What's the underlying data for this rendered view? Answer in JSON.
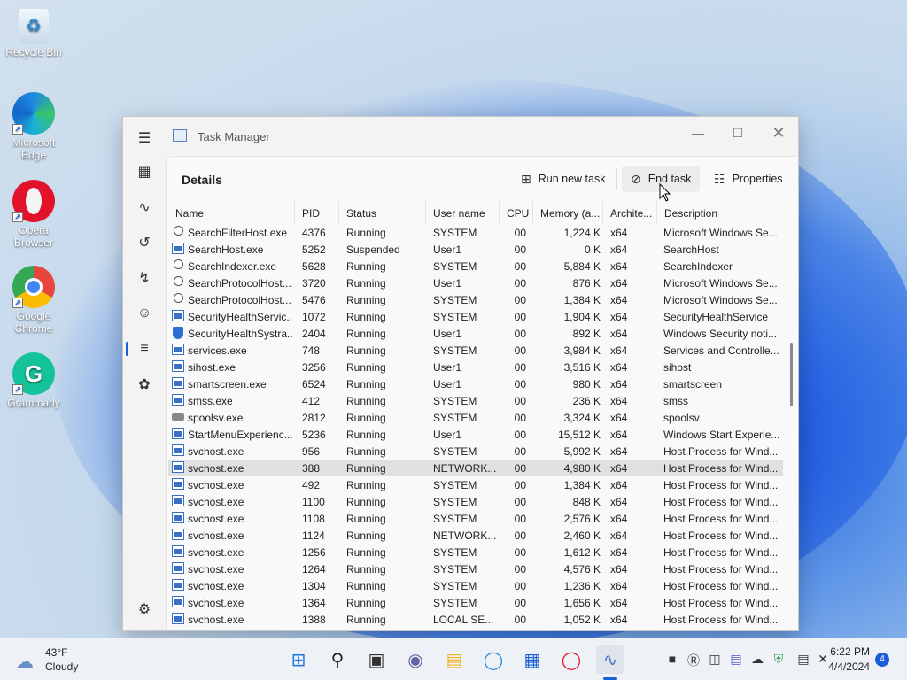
{
  "desktop": {
    "icons": [
      {
        "label": "Recycle Bin"
      },
      {
        "label": "Microsoft Edge"
      },
      {
        "label": "Opera Browser"
      },
      {
        "label": "Google Chrome"
      },
      {
        "label": "Grammarly"
      }
    ]
  },
  "window": {
    "title": "Task Manager",
    "page_title": "Details",
    "commands": {
      "run_new_task": "Run new task",
      "end_task": "End task",
      "properties": "Properties"
    }
  },
  "table": {
    "columns": [
      "Name",
      "PID",
      "Status",
      "User name",
      "CPU",
      "Memory (a...",
      "Archite...",
      "Description"
    ],
    "rows": [
      {
        "icon": "person",
        "name": "SearchFilterHost.exe",
        "pid": "4376",
        "status": "Running",
        "user": "SYSTEM",
        "cpu": "00",
        "mem": "1,224 K",
        "arch": "x64",
        "desc": "Microsoft Windows Se..."
      },
      {
        "icon": "app",
        "name": "SearchHost.exe",
        "pid": "5252",
        "status": "Suspended",
        "user": "User1",
        "cpu": "00",
        "mem": "0 K",
        "arch": "x64",
        "desc": "SearchHost"
      },
      {
        "icon": "person",
        "name": "SearchIndexer.exe",
        "pid": "5628",
        "status": "Running",
        "user": "SYSTEM",
        "cpu": "00",
        "mem": "5,884 K",
        "arch": "x64",
        "desc": "SearchIndexer"
      },
      {
        "icon": "person",
        "name": "SearchProtocolHost....",
        "pid": "3720",
        "status": "Running",
        "user": "User1",
        "cpu": "00",
        "mem": "876 K",
        "arch": "x64",
        "desc": "Microsoft Windows Se..."
      },
      {
        "icon": "person",
        "name": "SearchProtocolHost....",
        "pid": "5476",
        "status": "Running",
        "user": "SYSTEM",
        "cpu": "00",
        "mem": "1,384 K",
        "arch": "x64",
        "desc": "Microsoft Windows Se..."
      },
      {
        "icon": "app",
        "name": "SecurityHealthServic...",
        "pid": "1072",
        "status": "Running",
        "user": "SYSTEM",
        "cpu": "00",
        "mem": "1,904 K",
        "arch": "x64",
        "desc": "SecurityHealthService"
      },
      {
        "icon": "shield",
        "name": "SecurityHealthSystra...",
        "pid": "2404",
        "status": "Running",
        "user": "User1",
        "cpu": "00",
        "mem": "892 K",
        "arch": "x64",
        "desc": "Windows Security noti..."
      },
      {
        "icon": "app",
        "name": "services.exe",
        "pid": "748",
        "status": "Running",
        "user": "SYSTEM",
        "cpu": "00",
        "mem": "3,984 K",
        "arch": "x64",
        "desc": "Services and Controlle..."
      },
      {
        "icon": "app",
        "name": "sihost.exe",
        "pid": "3256",
        "status": "Running",
        "user": "User1",
        "cpu": "00",
        "mem": "3,516 K",
        "arch": "x64",
        "desc": "sihost"
      },
      {
        "icon": "app",
        "name": "smartscreen.exe",
        "pid": "6524",
        "status": "Running",
        "user": "User1",
        "cpu": "00",
        "mem": "980 K",
        "arch": "x64",
        "desc": "smartscreen"
      },
      {
        "icon": "app",
        "name": "smss.exe",
        "pid": "412",
        "status": "Running",
        "user": "SYSTEM",
        "cpu": "00",
        "mem": "236 K",
        "arch": "x64",
        "desc": "smss"
      },
      {
        "icon": "printer",
        "name": "spoolsv.exe",
        "pid": "2812",
        "status": "Running",
        "user": "SYSTEM",
        "cpu": "00",
        "mem": "3,324 K",
        "arch": "x64",
        "desc": "spoolsv"
      },
      {
        "icon": "app",
        "name": "StartMenuExperienc...",
        "pid": "5236",
        "status": "Running",
        "user": "User1",
        "cpu": "00",
        "mem": "15,512 K",
        "arch": "x64",
        "desc": "Windows Start Experie..."
      },
      {
        "icon": "app",
        "name": "svchost.exe",
        "pid": "956",
        "status": "Running",
        "user": "SYSTEM",
        "cpu": "00",
        "mem": "5,992 K",
        "arch": "x64",
        "desc": "Host Process for Wind..."
      },
      {
        "icon": "app",
        "name": "svchost.exe",
        "pid": "388",
        "status": "Running",
        "user": "NETWORK...",
        "cpu": "00",
        "mem": "4,980 K",
        "arch": "x64",
        "desc": "Host Process for Wind...",
        "selected": true
      },
      {
        "icon": "app",
        "name": "svchost.exe",
        "pid": "492",
        "status": "Running",
        "user": "SYSTEM",
        "cpu": "00",
        "mem": "1,384 K",
        "arch": "x64",
        "desc": "Host Process for Wind..."
      },
      {
        "icon": "app",
        "name": "svchost.exe",
        "pid": "1100",
        "status": "Running",
        "user": "SYSTEM",
        "cpu": "00",
        "mem": "848 K",
        "arch": "x64",
        "desc": "Host Process for Wind..."
      },
      {
        "icon": "app",
        "name": "svchost.exe",
        "pid": "1108",
        "status": "Running",
        "user": "SYSTEM",
        "cpu": "00",
        "mem": "2,576 K",
        "arch": "x64",
        "desc": "Host Process for Wind..."
      },
      {
        "icon": "app",
        "name": "svchost.exe",
        "pid": "1124",
        "status": "Running",
        "user": "NETWORK...",
        "cpu": "00",
        "mem": "2,460 K",
        "arch": "x64",
        "desc": "Host Process for Wind..."
      },
      {
        "icon": "app",
        "name": "svchost.exe",
        "pid": "1256",
        "status": "Running",
        "user": "SYSTEM",
        "cpu": "00",
        "mem": "1,612 K",
        "arch": "x64",
        "desc": "Host Process for Wind..."
      },
      {
        "icon": "app",
        "name": "svchost.exe",
        "pid": "1264",
        "status": "Running",
        "user": "SYSTEM",
        "cpu": "00",
        "mem": "4,576 K",
        "arch": "x64",
        "desc": "Host Process for Wind..."
      },
      {
        "icon": "app",
        "name": "svchost.exe",
        "pid": "1304",
        "status": "Running",
        "user": "SYSTEM",
        "cpu": "00",
        "mem": "1,236 K",
        "arch": "x64",
        "desc": "Host Process for Wind..."
      },
      {
        "icon": "app",
        "name": "svchost.exe",
        "pid": "1364",
        "status": "Running",
        "user": "SYSTEM",
        "cpu": "00",
        "mem": "1,656 K",
        "arch": "x64",
        "desc": "Host Process for Wind..."
      },
      {
        "icon": "app",
        "name": "svchost.exe",
        "pid": "1388",
        "status": "Running",
        "user": "LOCAL SE...",
        "cpu": "00",
        "mem": "1,052 K",
        "arch": "x64",
        "desc": "Host Process for Wind..."
      }
    ]
  },
  "taskbar": {
    "weather_temp": "43°F",
    "weather_desc": "Cloudy",
    "time": "6:22 PM",
    "date": "4/4/2024",
    "notifications": "4"
  }
}
